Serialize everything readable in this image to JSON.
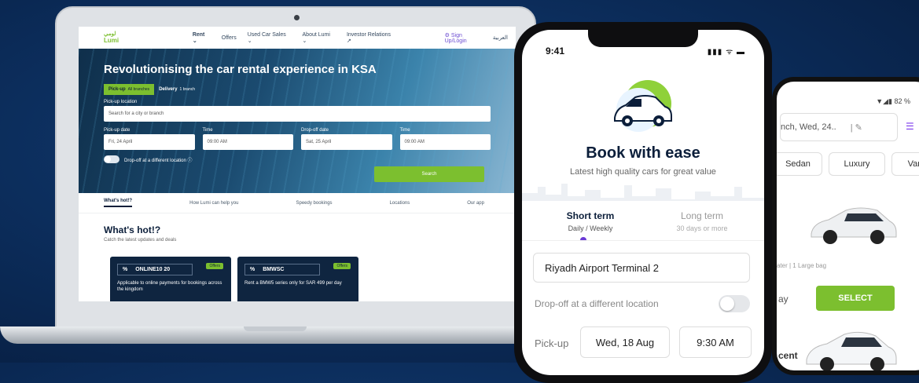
{
  "laptop": {
    "nav": {
      "logo_ar": "لومي",
      "logo_en": "Lumi",
      "items": [
        "Rent ⌄",
        "Offers",
        "Used Car Sales ⌄",
        "About Lumi ⌄",
        "Investor Relations ↗"
      ],
      "signup": "⚙ Sign Up/Login",
      "lang": "العربية"
    },
    "hero": {
      "title": "Revolutionising the car rental experience in KSA",
      "pill_pickup": "Pick-up",
      "pill_pickup_sub": "All branches",
      "pill_delivery": "Delivery",
      "pill_delivery_sub": "1 branch",
      "pickup_location_label": "Pick-up location",
      "pickup_location_placeholder": "Search for a city or branch",
      "pickup_date_label": "Pick-up date",
      "pickup_date": "Fri, 24 April",
      "time_label": "Time",
      "pickup_time": "09:00 AM",
      "dropoff_date_label": "Drop-off date",
      "dropoff_date": "Sat, 25 April",
      "dropoff_time_label": "Time",
      "dropoff_time": "09:00 AM",
      "dropoff_diff": "Drop-off at a different location ⓘ",
      "search": "Search"
    },
    "tabs": [
      "What's hot!?",
      "How Lumi can help you",
      "Speedy bookings",
      "Locations",
      "Our app"
    ],
    "hot": {
      "title": "What's hot!?",
      "subtitle": "Catch the latest updates and deals",
      "cards": [
        {
          "code": "ONLINE10 20",
          "badge": "Offers",
          "desc": "Applicable to online payments for bookings across the kingdom"
        },
        {
          "code": "BMWSC",
          "badge": "Offers",
          "desc": "Rent a BMW5 series only for SAR 499 per day"
        }
      ]
    }
  },
  "phone_front": {
    "time": "9:41",
    "status": "▮▮▮ ᯤ ▬",
    "title": "Book with ease",
    "subtitle": "Latest high quality cars for great value",
    "tab_short_title": "Short term",
    "tab_short_sub": "Daily / Weekly",
    "tab_long_title": "Long term",
    "tab_long_sub": "30 days or more",
    "location": "Riyadh Airport Terminal 2",
    "dropoff": "Drop-off at a different location",
    "pickup_label": "Pick-up",
    "pickup_date": "Wed, 18 Aug",
    "pickup_time": "9:30 AM"
  },
  "phone_back": {
    "status": "▼◢▮ 82 %",
    "search_text": "nch, Wed, 24..",
    "chips": [
      "Sedan",
      "Luxury",
      "Van"
    ],
    "spec": "ater | 1 Large bag",
    "partial": "ay",
    "select": "SELECT",
    "partial2": "cent"
  },
  "colors": {
    "accent_green": "#7cbf2f",
    "navy": "#0b1e3a",
    "purple": "#6b3ad6"
  }
}
